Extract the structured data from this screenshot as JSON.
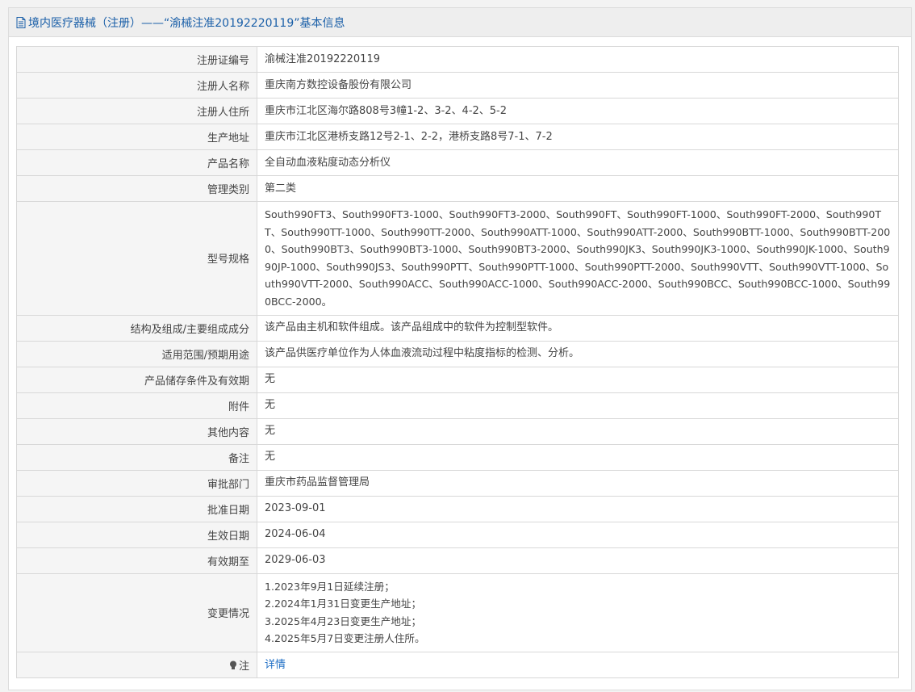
{
  "header": {
    "title": "境内医疗器械（注册）——“渝械注准20192220119”基本信息"
  },
  "fields": {
    "reg_no": {
      "label": "注册证编号",
      "value": "渝械注准20192220119"
    },
    "registrant": {
      "label": "注册人名称",
      "value": "重庆南方数控设备股份有限公司"
    },
    "registrant_address": {
      "label": "注册人住所",
      "value": "重庆市江北区海尔路808号3幢1-2、3-2、4-2、5-2"
    },
    "production_address": {
      "label": "生产地址",
      "value": "重庆市江北区港桥支路12号2-1、2-2，港桥支路8号7-1、7-2"
    },
    "product_name": {
      "label": "产品名称",
      "value": "全自动血液粘度动态分析仪"
    },
    "category": {
      "label": "管理类别",
      "value": "第二类"
    },
    "models": {
      "label": "型号规格",
      "value": "South990FT3、South990FT3-1000、South990FT3-2000、South990FT、South990FT-1000、South990FT-2000、South990TT、South990TT-1000、South990TT-2000、South990ATT-1000、South990ATT-2000、South990BTT-1000、South990BTT-2000、South990BT3、South990BT3-1000、South990BT3-2000、South990JK3、South990JK3-1000、South990JK-1000、South990JP-1000、South990JS3、South990PTT、South990PTT-1000、South990PTT-2000、South990VTT、South990VTT-1000、South990VTT-2000、South990ACC、South990ACC-1000、South990ACC-2000、South990BCC、South990BCC-1000、South990BCC-2000。"
    },
    "structure": {
      "label": "结构及组成/主要组成成分",
      "value": "该产品由主机和软件组成。该产品组成中的软件为控制型软件。"
    },
    "scope": {
      "label": "适用范围/预期用途",
      "value": "该产品供医疗单位作为人体血液流动过程中粘度指标的检测、分析。"
    },
    "storage": {
      "label": "产品储存条件及有效期",
      "value": "无"
    },
    "attachment": {
      "label": "附件",
      "value": "无"
    },
    "other": {
      "label": "其他内容",
      "value": "无"
    },
    "remark": {
      "label": "备注",
      "value": "无"
    },
    "approval_dept": {
      "label": "审批部门",
      "value": "重庆市药品监督管理局"
    },
    "approval_date": {
      "label": "批准日期",
      "value": "2023-09-01"
    },
    "effective_date": {
      "label": "生效日期",
      "value": "2024-06-04"
    },
    "expiry_date": {
      "label": "有效期至",
      "value": "2029-06-03"
    },
    "changes": {
      "label": "变更情况",
      "lines": [
        "1.2023年9月1日延续注册；",
        "2.2024年1月31日变更生产地址；",
        "3.2025年4月23日变更生产地址；",
        "4.2025年5月7日变更注册人住所。"
      ]
    },
    "note": {
      "label": "注",
      "link_text": "详情"
    }
  },
  "colors": {
    "header_text": "#1a5fa8",
    "link": "#1f6fc5",
    "label_bg": "#f5f5f5",
    "border": "#d8d8d8"
  },
  "icons": {
    "header": "document-icon",
    "note": "lightbulb-icon"
  }
}
